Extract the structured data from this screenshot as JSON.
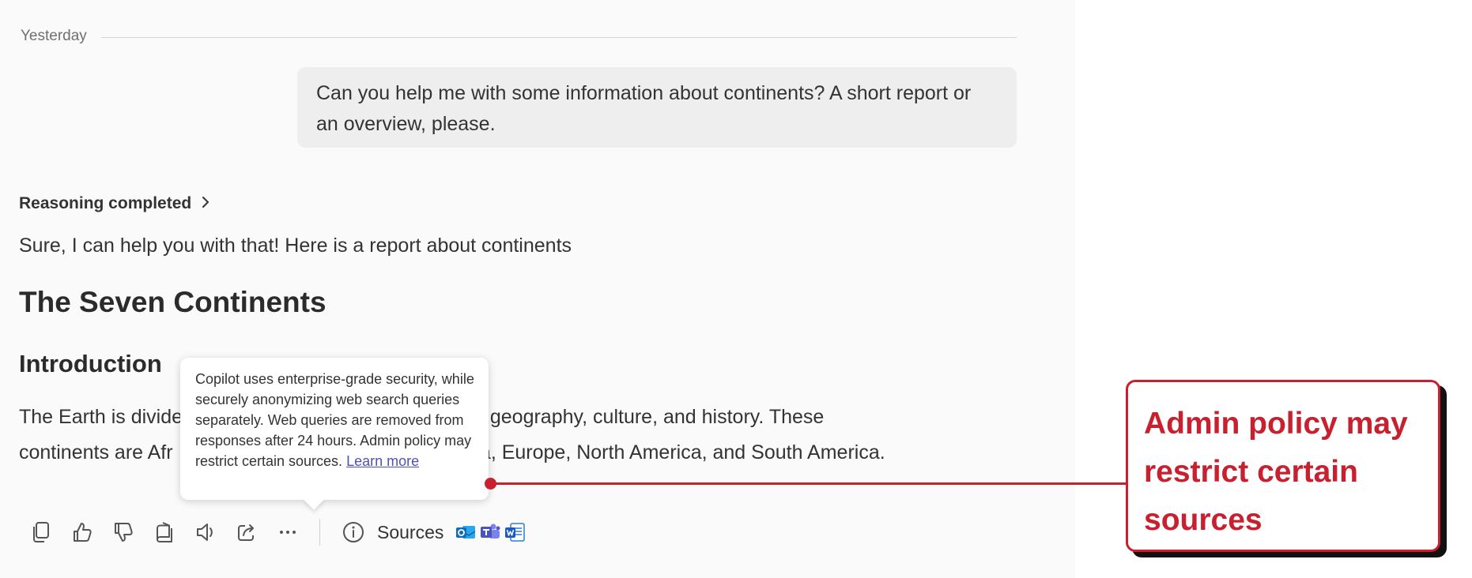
{
  "chat": {
    "date_divider": "Yesterday",
    "user_message": "Can you help me with some information about continents? A short report or an overview, please.",
    "reasoning_label": "Reasoning completed",
    "reply_intro": "Sure, I can help you with that! Here is a report about continents",
    "heading": "The Seven Continents",
    "subheading": "Introduction",
    "paragraph_line1_start": "The Earth is divide",
    "paragraph_line1_end": "n its unique geography, culture, and history. These",
    "paragraph_line2_start": "continents are Afr",
    "paragraph_line2_end": "ania, Europe, North America, and South America."
  },
  "tooltip": {
    "text": "Copilot uses enterprise-grade security, while securely anonymizing web search queries separately. Web queries are removed from responses after 24 hours. Admin policy may restrict certain sources.",
    "link": "Learn more"
  },
  "toolbar": {
    "sources_label": "Sources",
    "icons": [
      "copy-icon",
      "thumbs-up-icon",
      "thumbs-down-icon",
      "pages-icon",
      "read-aloud-icon",
      "share-icon",
      "more-icon",
      "info-icon"
    ],
    "source_apps": [
      "outlook-icon",
      "teams-icon",
      "word-icon"
    ]
  },
  "callout": {
    "text": "Admin policy may restrict certain sources",
    "color": "#c8202f"
  }
}
